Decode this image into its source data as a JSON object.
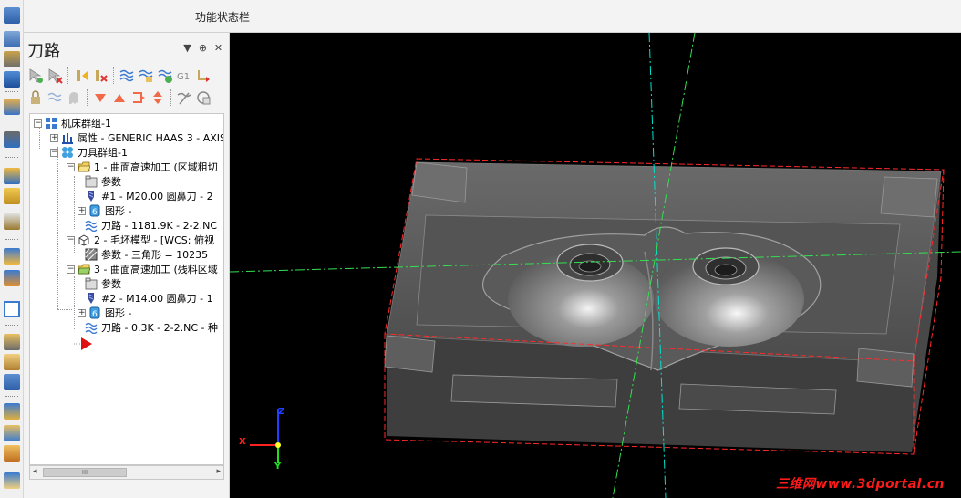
{
  "topbar": {
    "title": "功能状态栏"
  },
  "panel": {
    "title": "刀路",
    "controls": [
      "▼",
      "⊕",
      "✕"
    ]
  },
  "tree": {
    "root": "机床群组-1",
    "properties": "属性 - GENERIC HAAS 3 - AXIS",
    "toolgroup": "刀具群组-1",
    "op1": {
      "label": "1 - 曲面高速加工 (区域粗切",
      "params": "参数",
      "tool": "#1 - M20.00 圆鼻刀 - 2",
      "geometry": "图形 -",
      "toolpath": "刀路 - 1181.9K - 2-2.NC"
    },
    "op2": {
      "label": "2 - 毛坯模型 - [WCS: 俯视",
      "params": "参数 - 三角形 =  10235"
    },
    "op3": {
      "label": "3 - 曲面高速加工 (残料区域",
      "params": "参数",
      "tool": "#2 - M14.00 圆鼻刀 - 1",
      "geometry": "图形 -",
      "toolpath": "刀路 - 0.3K - 2-2.NC - 种"
    }
  },
  "scroll": {
    "thumb": "III",
    "left": "◂",
    "right": "▸"
  },
  "axes": {
    "x": "X",
    "y": "Y",
    "z": "Z"
  },
  "watermark": "三维网www.3dportal.cn",
  "colors": {
    "viewport_bg": "#000000",
    "stock_outline": "#ff2a2a",
    "axis_cyan": "#00e5d0",
    "axis_green": "#35e050",
    "part": "#5a5a5a"
  }
}
